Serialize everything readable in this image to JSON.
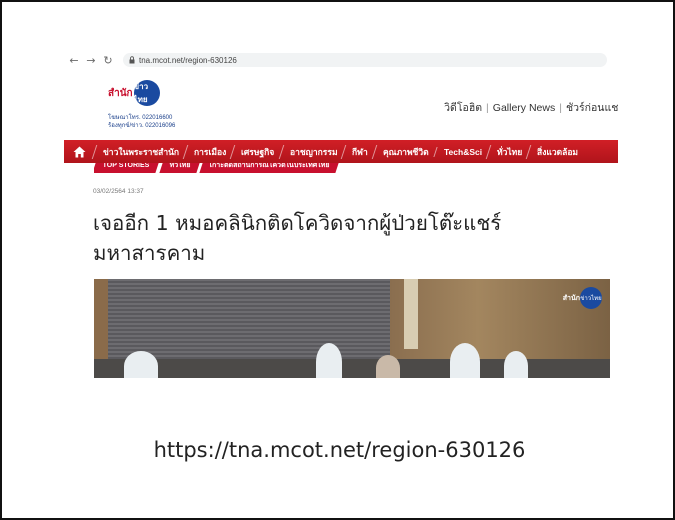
{
  "browser": {
    "url": "tna.mcot.net/region-630126"
  },
  "site": {
    "logo_text": "สำนัก",
    "logo_circle_text": "ข่าวไทย",
    "phone_1": "โฆษณาโทร. 022016600",
    "phone_2": "ร้องทุกข์/ข่าว. 022016096",
    "header_links": [
      "วิดีโอฮิต",
      "Gallery News",
      "ชัวร์ก่อนแชร์"
    ]
  },
  "nav": {
    "items": [
      "ข่าวในพระราชสำนัก",
      "การเมือง",
      "เศรษฐกิจ",
      "อาชญากรรม",
      "กีฬา",
      "คุณภาพชีวิต",
      "Tech&Sci",
      "ทั่วไทย",
      "สิ่งแวดล้อม"
    ],
    "subtabs": [
      "TOP STORIES",
      "ทั่วไทย",
      "เกาะติดสถานการณ์โควิดในประเทศไทย"
    ]
  },
  "article": {
    "date": "03/02/2564 13:37",
    "headline": "เจออีก 1 หมอคลินิกติดโควิดจากผู้ป่วยโต๊ะแชร์ มหาสารคาม",
    "photo_badge": "สำนัก",
    "photo_badge_circle": "ข่าวไทย"
  },
  "caption": {
    "url": "https://tna.mcot.net/region-630126"
  },
  "colors": {
    "brand_red": "#c8102e",
    "brand_blue": "#1a4aa0"
  }
}
